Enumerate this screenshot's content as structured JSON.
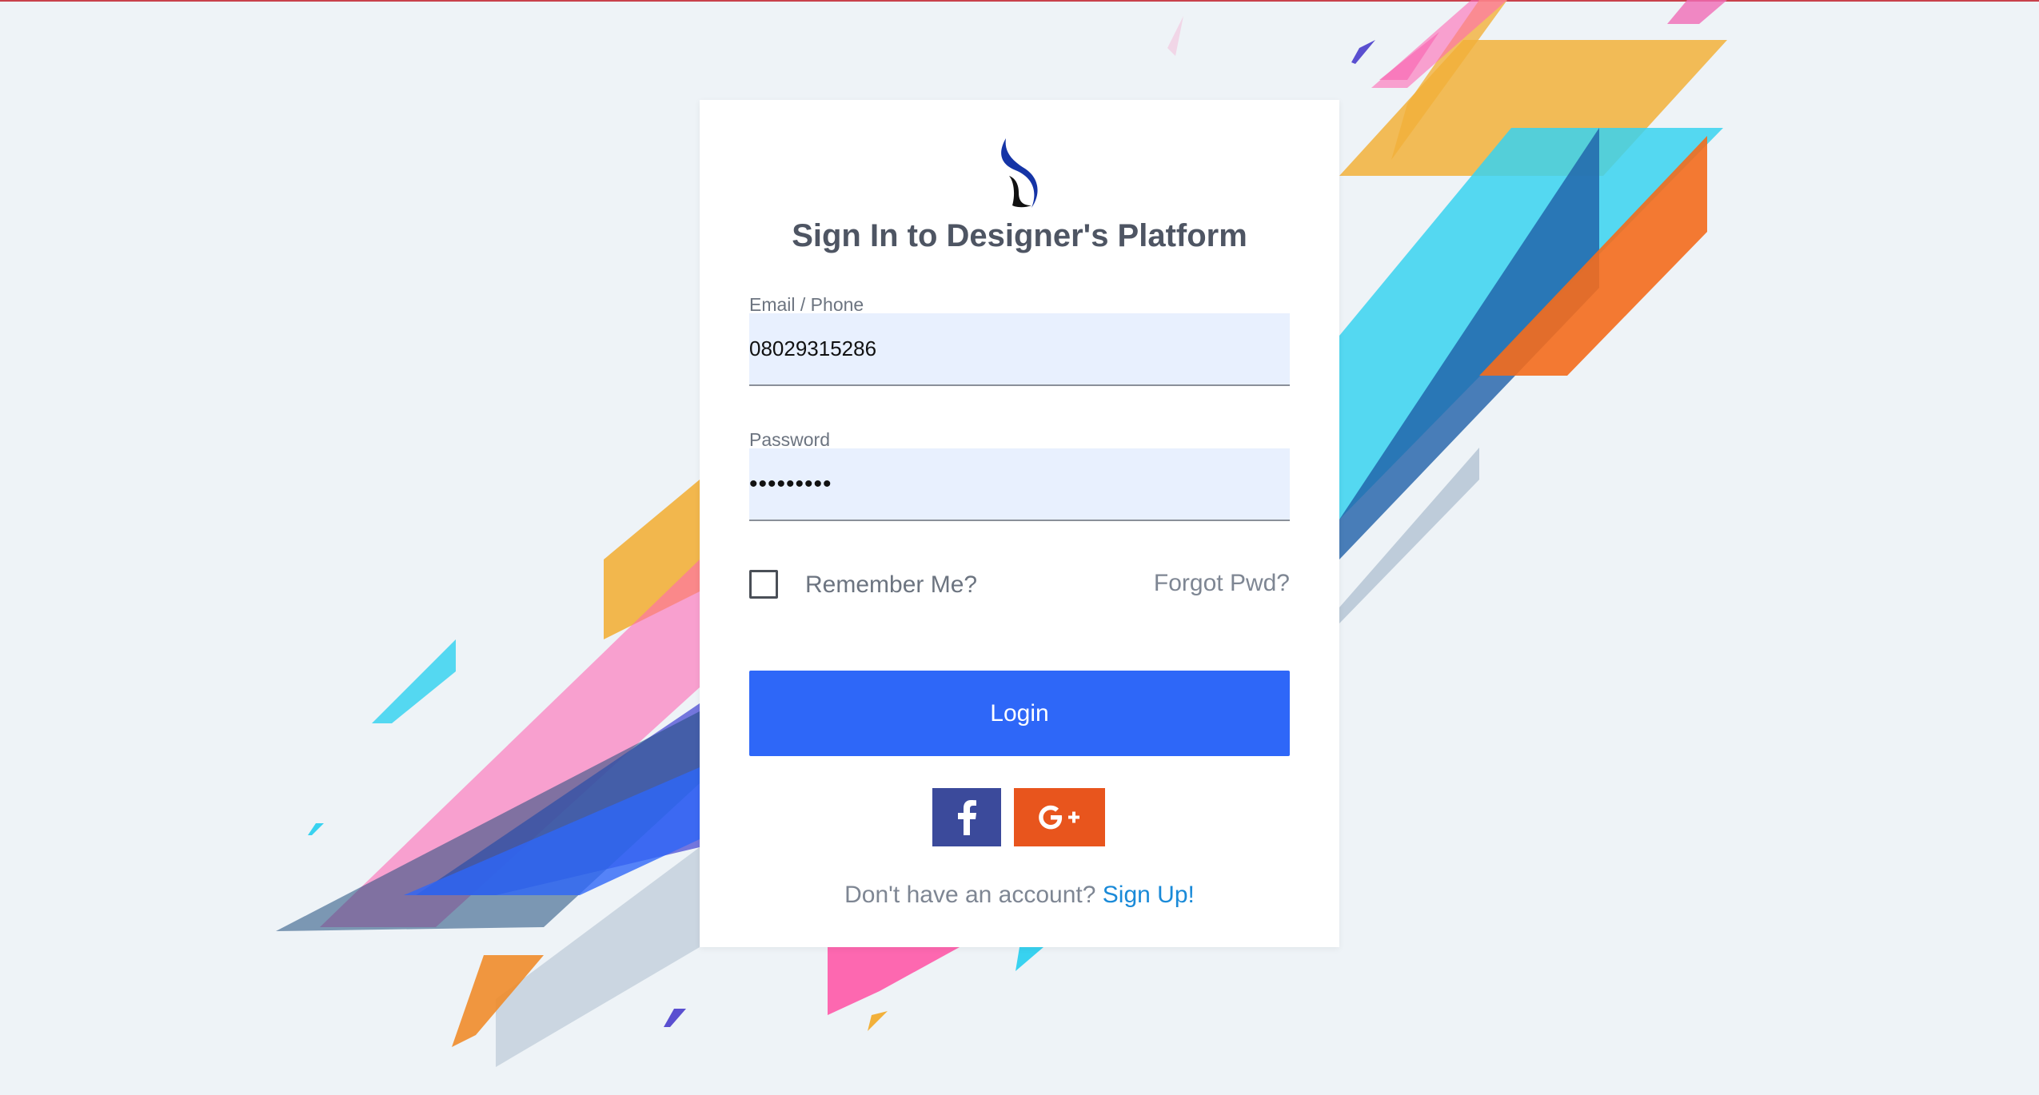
{
  "page": {
    "title": "Sign In to Designer's Platform"
  },
  "form": {
    "email_label": "Email / Phone",
    "email_value": "08029315286",
    "password_label": "Password",
    "password_value": "•••••••••",
    "remember_label": "Remember Me?",
    "forgot_label": "Forgot Pwd?",
    "login_label": "Login",
    "remember_checked": false
  },
  "social": {
    "facebook_icon": "facebook-icon",
    "google_plus_icon": "google-plus-icon",
    "facebook_color": "#3b4a9b",
    "google_plus_color": "#e8551d"
  },
  "footer": {
    "prompt": "Don't have an account?",
    "signup_label": "Sign Up!"
  },
  "colors": {
    "accent": "#2e67f8",
    "link": "#1a8ad8",
    "field_bg": "#e8f0fe"
  }
}
